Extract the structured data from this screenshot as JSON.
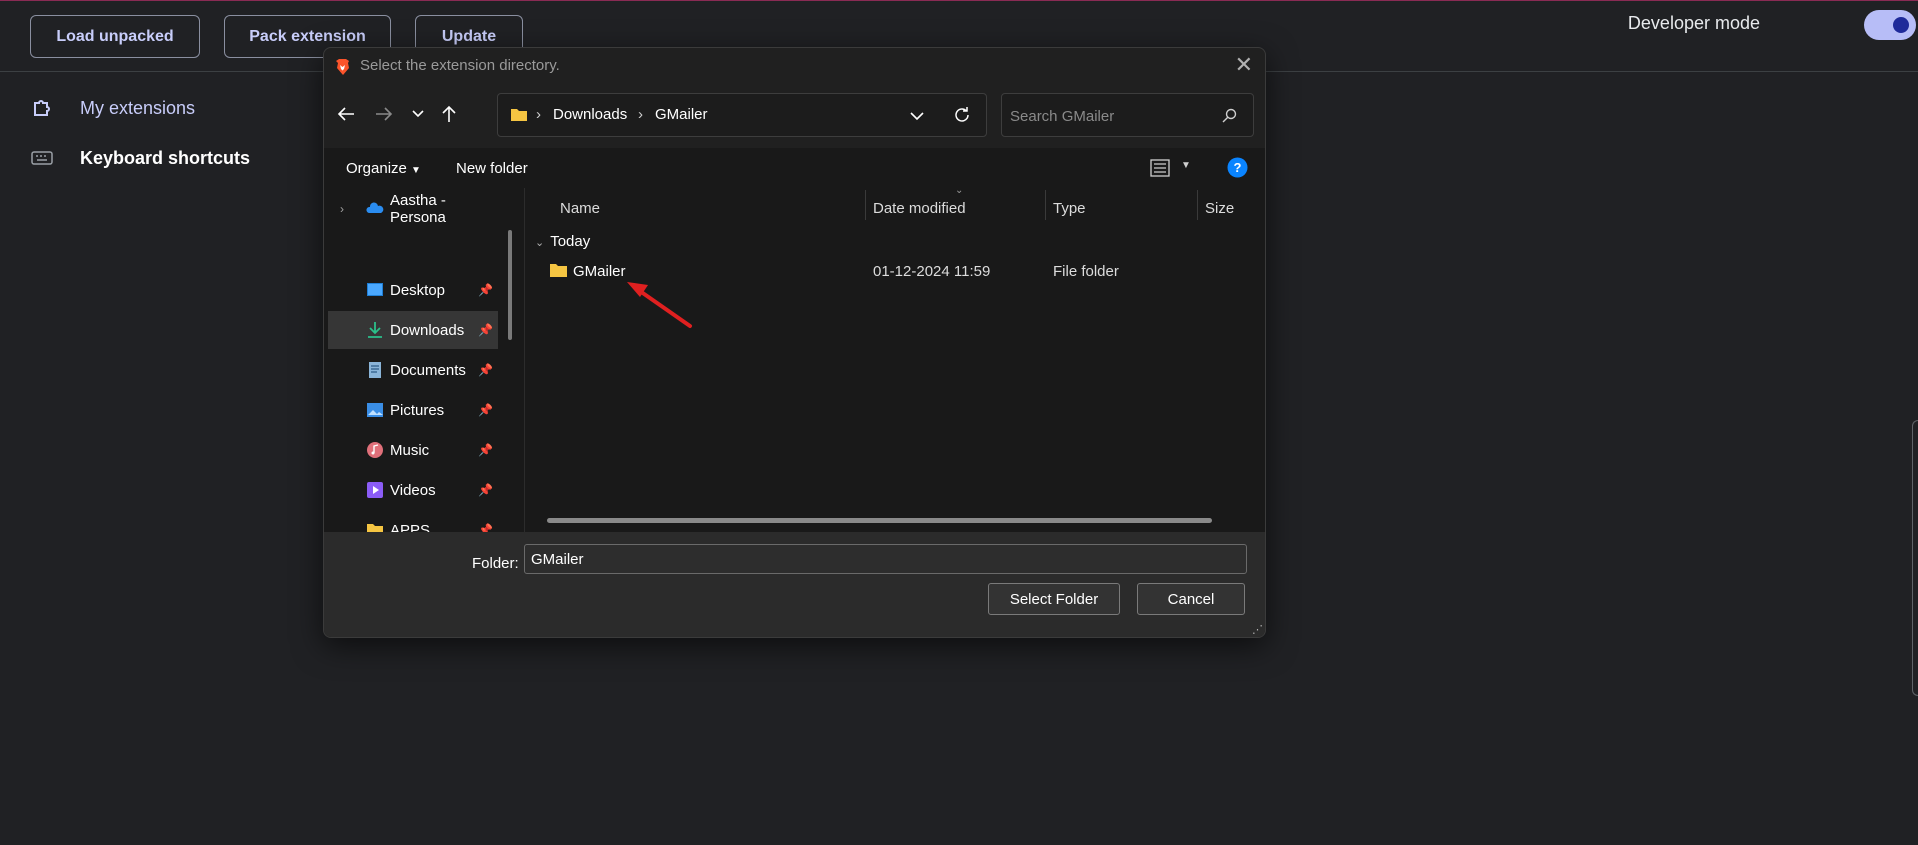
{
  "toolbar": {
    "load_unpacked": "Load unpacked",
    "pack_extension": "Pack extension",
    "update": "Update",
    "developer_mode": "Developer mode",
    "developer_mode_on": true
  },
  "sidebar": {
    "items": [
      {
        "label": "My extensions",
        "icon": "puzzle-icon"
      },
      {
        "label": "Keyboard shortcuts",
        "icon": "keyboard-icon"
      }
    ]
  },
  "dialog": {
    "title": "Select the extension directory.",
    "breadcrumb": [
      "Downloads",
      "GMailer"
    ],
    "search_placeholder": "Search GMailer",
    "organize": "Organize",
    "new_folder": "New folder",
    "nav_pane": [
      {
        "label": "Aastha - Persona",
        "icon": "onedrive-icon",
        "pinned": false
      },
      {
        "label": "Desktop",
        "icon": "desktop-icon",
        "pinned": true
      },
      {
        "label": "Downloads",
        "icon": "download-icon",
        "pinned": true,
        "selected": true
      },
      {
        "label": "Documents",
        "icon": "documents-icon",
        "pinned": true
      },
      {
        "label": "Pictures",
        "icon": "pictures-icon",
        "pinned": true
      },
      {
        "label": "Music",
        "icon": "music-icon",
        "pinned": true
      },
      {
        "label": "Videos",
        "icon": "videos-icon",
        "pinned": true
      },
      {
        "label": "APPS",
        "icon": "folder-icon",
        "pinned": true
      }
    ],
    "columns": [
      "Name",
      "Date modified",
      "Type",
      "Size"
    ],
    "group_label": "Today",
    "files": [
      {
        "name": "GMailer",
        "date_modified": "01-12-2024 11:59",
        "type": "File folder",
        "size": ""
      }
    ],
    "folder_label": "Folder:",
    "folder_value": "GMailer",
    "select_folder": "Select Folder",
    "cancel": "Cancel"
  },
  "colors": {
    "page_bg": "#202124",
    "accent": "#c8cdfa",
    "annotation_arrow": "#e02020",
    "folder_yellow": "#f5c542"
  }
}
